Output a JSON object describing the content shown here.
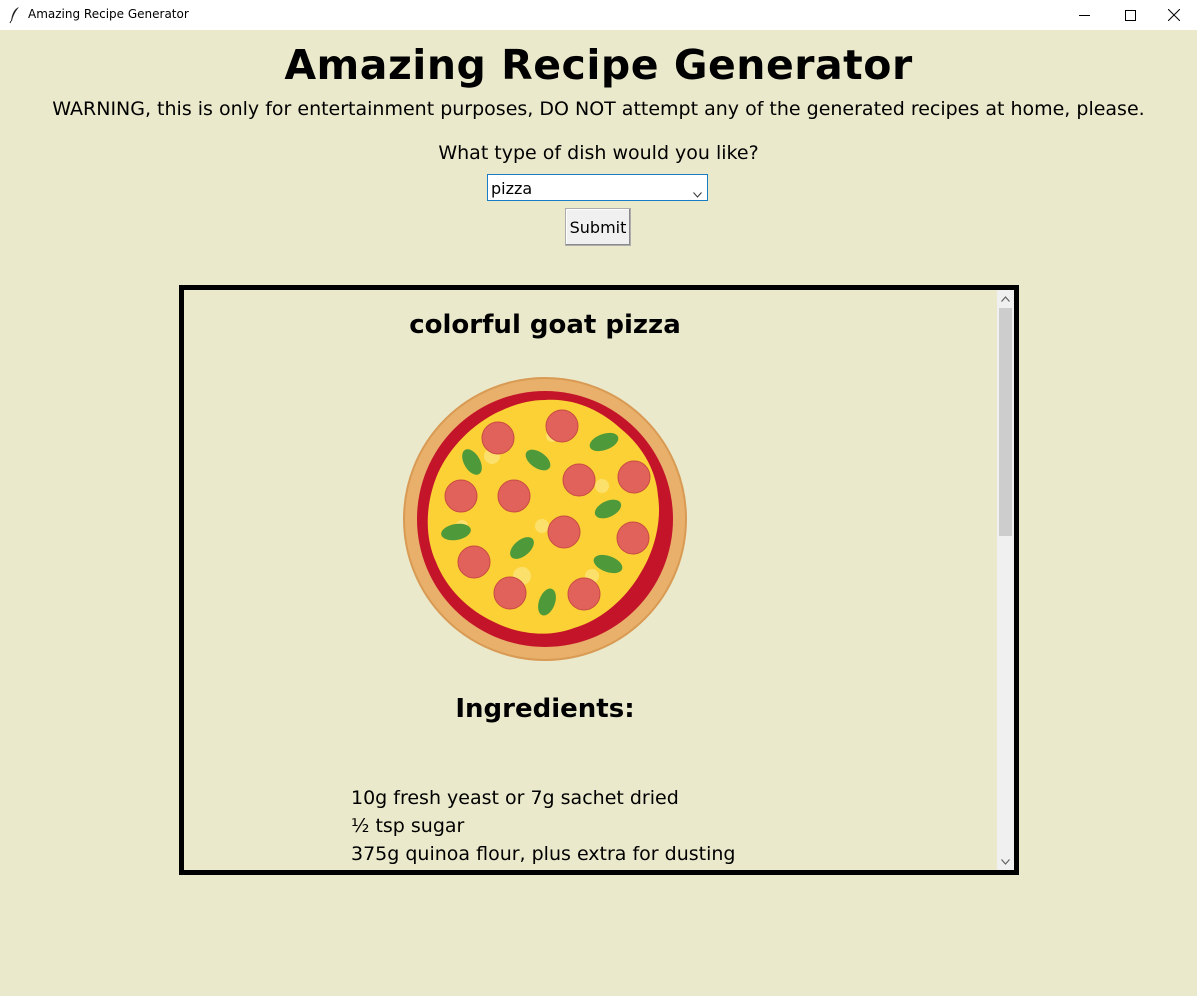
{
  "window": {
    "title": "Amazing Recipe Generator",
    "icon": "feather-icon",
    "controls": [
      "minimize-icon",
      "maximize-icon",
      "close-icon"
    ]
  },
  "header": {
    "title": "Amazing Recipe Generator",
    "warning": "WARNING, this is only for entertainment purposes, DO NOT attempt any of the generated recipes at home, please."
  },
  "form": {
    "question": "What type of dish would you like?",
    "dish_value": "pizza",
    "submit_label": "Submit"
  },
  "recipe": {
    "title": "colorful goat pizza",
    "image": "pizza-illustration",
    "ingredients_heading": "Ingredients:",
    "ingredients": [
      "10g fresh yeast or 7g sachet dried",
      "½ tsp sugar",
      "375g quinoa flour, plus extra for dusting"
    ]
  },
  "colors": {
    "background": "#EAE9CB",
    "titlebar": "#FFFFFF",
    "focus_border": "#1A7DC4"
  }
}
